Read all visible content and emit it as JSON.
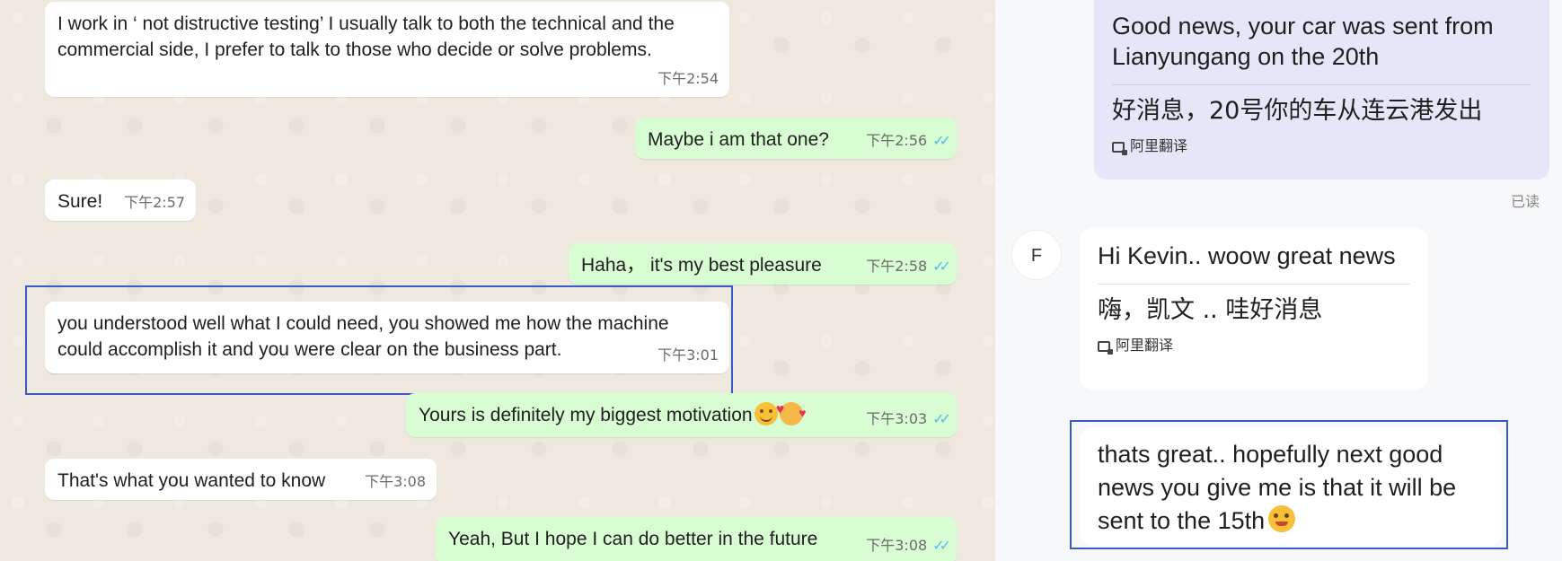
{
  "left_chat": {
    "messages": [
      {
        "dir": "in",
        "text": "I work in ‘ not distructive testing’ I usually talk to both the technical and the commercial side, I prefer to talk to those who decide or solve problems.",
        "time": "下午2:54"
      },
      {
        "dir": "out",
        "text": "Maybe i am that one?",
        "time": "下午2:56"
      },
      {
        "dir": "in",
        "text": "Sure!",
        "time": "下午2:57"
      },
      {
        "dir": "out",
        "text": "Haha， it's my  best pleasure",
        "time": "下午2:58"
      },
      {
        "dir": "in",
        "text": "you understood well what I could need, you showed me how the machine could accomplish it and you were clear on the business part.",
        "time": "下午3:01"
      },
      {
        "dir": "out",
        "text": "Yours is definitely my biggest motivation",
        "time": "下午3:03",
        "emojis": [
          "smiling-face-emoji",
          "smiling-face-with-hearts-emoji"
        ]
      },
      {
        "dir": "in",
        "text": "That's what you wanted to know",
        "time": "下午3:08"
      },
      {
        "dir": "out",
        "text": "Yeah, But I hope I can do better in the future",
        "time": "下午3:08"
      }
    ],
    "read_ticks": "✓✓"
  },
  "right_chat": {
    "sent_message": {
      "text_en": "Good news, your car was sent from Lianyungang on the 20th",
      "text_zh": "好消息，20号你的车从连云港发出",
      "translator": "阿里翻译",
      "status": "已读"
    },
    "received_message": {
      "avatar": "F",
      "text_en": "Hi Kevin.. woow great news",
      "text_zh": "嗨，凯文 .. 哇好消息",
      "translator": "阿里翻译"
    },
    "received_message_2": {
      "text": "thats great.. hopefully next good news you give me is that it will be sent to the 15th",
      "emoji": "grimacing-smile-emoji"
    }
  },
  "colors": {
    "incoming_bubble": "#ffffff",
    "outgoing_bubble": "#d9fdd3",
    "highlight_border": "#3a5bc7",
    "read_tick": "#53bdeb",
    "right_sent_bubble": "#e5e6f7"
  }
}
